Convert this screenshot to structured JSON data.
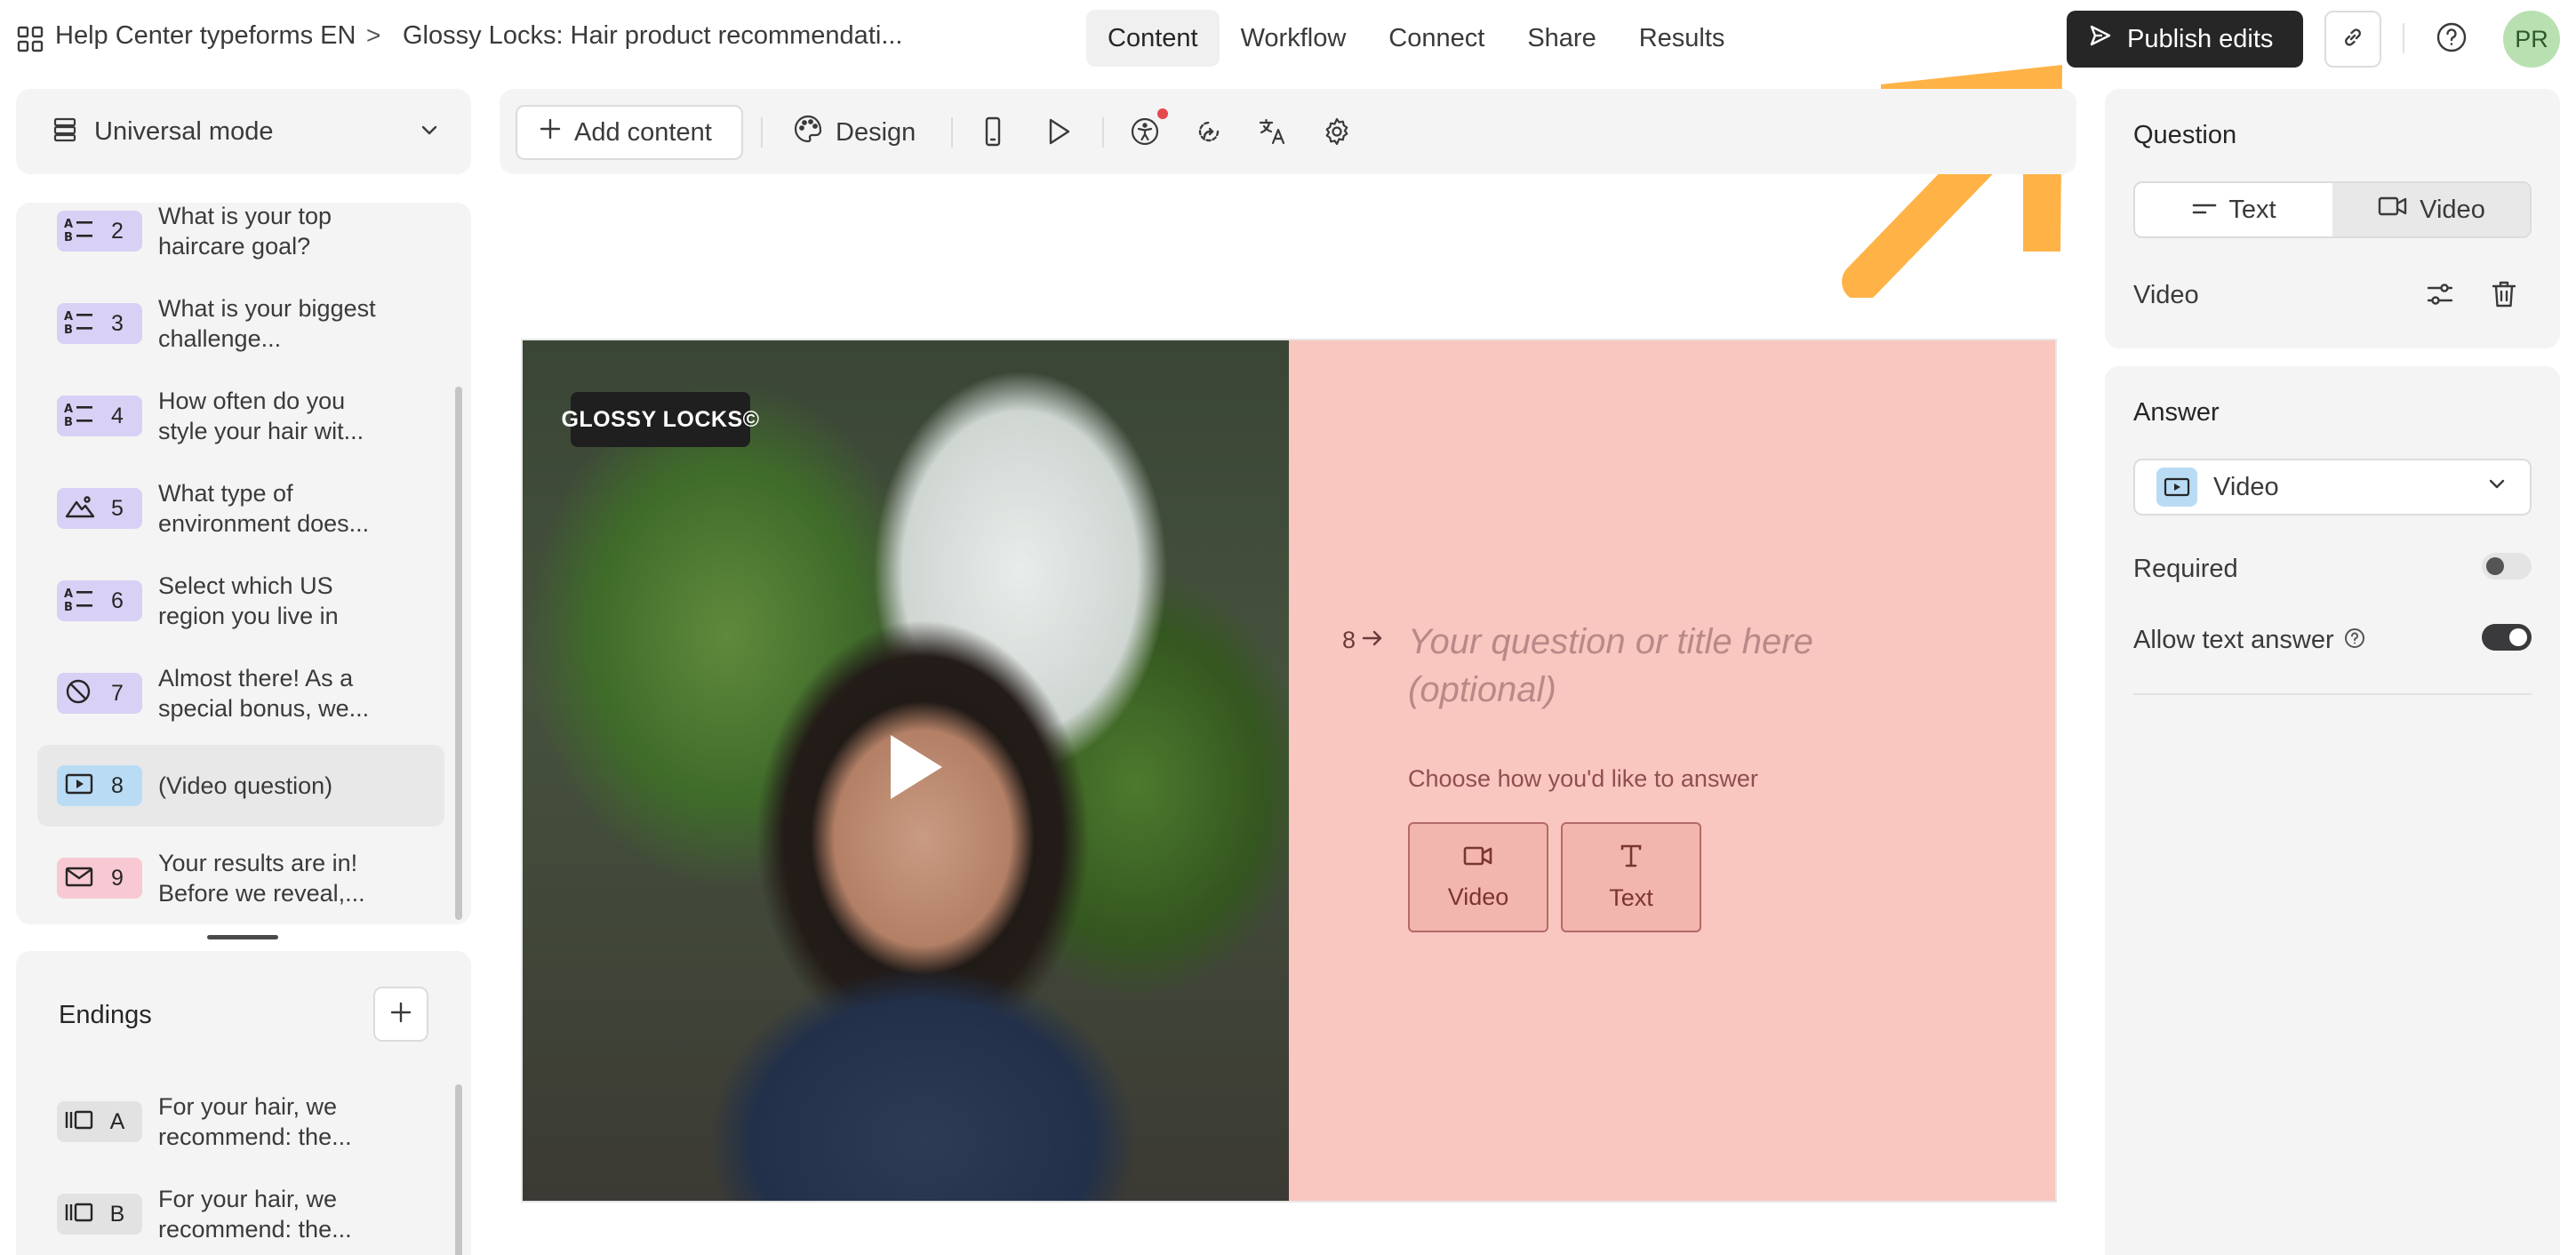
{
  "header": {
    "workspace": "Help Center typeforms EN",
    "separator": ">",
    "form_title": "Glossy Locks: Hair product recommendati...",
    "tabs": [
      "Content",
      "Workflow",
      "Connect",
      "Share",
      "Results"
    ],
    "active_tab": "Content",
    "publish_label": "Publish edits",
    "avatar_initials": "PR"
  },
  "sidebar": {
    "mode_label": "Universal mode",
    "questions": [
      {
        "num": "2",
        "text": "What is your top haircare goal?",
        "icon": "multiple-choice-icon",
        "color": "#d9d0f5"
      },
      {
        "num": "3",
        "text": "What is your biggest challenge...",
        "icon": "multiple-choice-icon",
        "color": "#d9d0f5"
      },
      {
        "num": "4",
        "text": "How often do you style your hair wit...",
        "icon": "multiple-choice-icon",
        "color": "#d9d0f5"
      },
      {
        "num": "5",
        "text": "What type of environment does...",
        "icon": "picture-choice-icon",
        "color": "#d9d0f5"
      },
      {
        "num": "6",
        "text": "Select which US region you live in",
        "icon": "multiple-choice-icon",
        "color": "#d9d0f5"
      },
      {
        "num": "7",
        "text": "Almost there! As a special bonus, we...",
        "icon": "no-entry-icon",
        "color": "#d9d0f5"
      },
      {
        "num": "8",
        "text": "(Video question)",
        "icon": "video-icon",
        "color": "#b9dcf4"
      },
      {
        "num": "9",
        "text": "Your results are in! Before we reveal,...",
        "icon": "email-icon",
        "color": "#f8c9d2"
      }
    ],
    "endings_title": "Endings",
    "endings": [
      {
        "letter": "A",
        "text": "For your hair, we recommend: the...",
        "icon": "ending-icon"
      },
      {
        "letter": "B",
        "text": "For your hair, we recommend: the...",
        "icon": "ending-icon"
      }
    ]
  },
  "toolbar": {
    "add_content_label": "Add content",
    "design_label": "Design"
  },
  "canvas": {
    "logo_text": "GLOSSY LOCKS©",
    "question_number": "8",
    "title_placeholder": "Your question or title here (optional)",
    "choose_label": "Choose how you'd like to answer",
    "answer_options": [
      "Video",
      "Text"
    ]
  },
  "right_panel": {
    "question_title": "Question",
    "format_options": [
      "Text",
      "Video"
    ],
    "active_format": "Video",
    "video_label": "Video",
    "answer_title": "Answer",
    "answer_type": "Video",
    "required_label": "Required",
    "required_on": false,
    "allow_text_label": "Allow text answer",
    "allow_text_on": true
  },
  "colors": {
    "publish_bg": "#262627",
    "canvas_right_bg": "#f9c7bf",
    "arrow": "#ffb347",
    "avatar_bg": "#b8e0b0"
  }
}
